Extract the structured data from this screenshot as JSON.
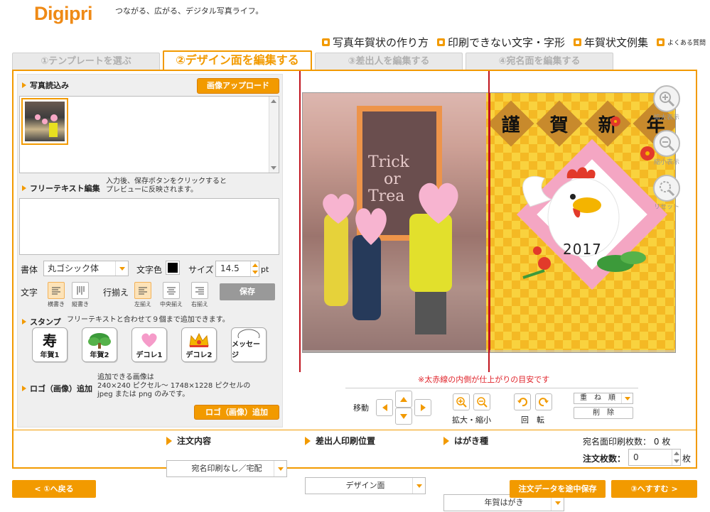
{
  "brand": {
    "logo": "Digipri",
    "tagline": "つながる、広がる、デジタル写真ライフ。"
  },
  "toplinks": [
    {
      "label": "写真年賀状の作り方"
    },
    {
      "label": "印刷できない文字・字形"
    },
    {
      "label": "年賀状文例集"
    },
    {
      "label": "よくある質問"
    }
  ],
  "tabs": [
    {
      "label": "①テンプレートを選ぶ"
    },
    {
      "label": "②デザイン面を編集する"
    },
    {
      "label": "③差出人を編集する"
    },
    {
      "label": "④宛名面を編集する"
    }
  ],
  "photo": {
    "heading": "写真読込み",
    "upload_button": "画像アップロード"
  },
  "freetext": {
    "heading": "フリーテキスト編集",
    "note_line1": "入力後、保存ボタンをクリックすると",
    "note_line2": "プレビューに反映されます。",
    "value": ""
  },
  "format": {
    "font_label": "書体",
    "font_value": "丸ゴシック体",
    "color_label": "文字色",
    "color_value": "#000000",
    "size_label": "サイズ",
    "size_value": "14.5",
    "size_unit": "pt",
    "text_label": "文字",
    "dir_captions": [
      "横書き",
      "縦書き"
    ],
    "align_label": "行揃え",
    "align_captions": [
      "左揃え",
      "中央揃え",
      "右揃え"
    ],
    "save_button": "保存"
  },
  "stamp": {
    "heading": "スタンプ",
    "note": "フリーテキストと合わせて９個まで追加できます。",
    "items": [
      {
        "label": "年賀1",
        "icon": "kotobuki-icon"
      },
      {
        "label": "年賀2",
        "icon": "pine-icon"
      },
      {
        "label": "デコレ1",
        "icon": "heart-icon"
      },
      {
        "label": "デコレ2",
        "icon": "crown-icon"
      },
      {
        "label": "メッセージ",
        "icon": "speech-bubble-icon"
      }
    ]
  },
  "logo_section": {
    "heading": "ロゴ（画像）追加",
    "note_line1": "追加できる画像は",
    "note_line2": "240×240 ピクセル～ 1748×1228 ピクセルの",
    "note_line3": "jpeg または png のみです。",
    "button": "ロゴ（画像）追加"
  },
  "card": {
    "greeting": [
      "謹",
      "賀",
      "新",
      "年"
    ],
    "year": "2017",
    "sign_text": [
      "Trick",
      "or",
      "Trea"
    ]
  },
  "zoom": {
    "enlarge": "拡大表示",
    "shrink": "縮小表示",
    "reset": "リセット"
  },
  "guide_note": "※太赤線の内側が仕上がりの目安です",
  "controls": {
    "move": "移動",
    "scale": "拡大・縮小",
    "rotate": "回　転",
    "order": "重　ね　順",
    "delete": "削　除"
  },
  "order": {
    "content": {
      "label": "注文内容",
      "value": "宛名印刷なし／宅配"
    },
    "sender": {
      "label": "差出人印刷位置",
      "value": "デザイン面"
    },
    "card_type": {
      "label": "はがき種",
      "value": "年賀はがき"
    },
    "address_count": {
      "label": "宛名面印刷枚数：",
      "value": "0",
      "unit": "枚"
    },
    "qty": {
      "label": "注文枚数：",
      "value": "0",
      "unit": "枚"
    }
  },
  "nav": {
    "back": "< ①へ戻る",
    "save_mid": "注文データを途中保存",
    "next": "③へすすむ >"
  },
  "colors": {
    "accent": "#f29a00",
    "guide_red": "#c0141e",
    "card_yellow": "#f9d23e"
  }
}
